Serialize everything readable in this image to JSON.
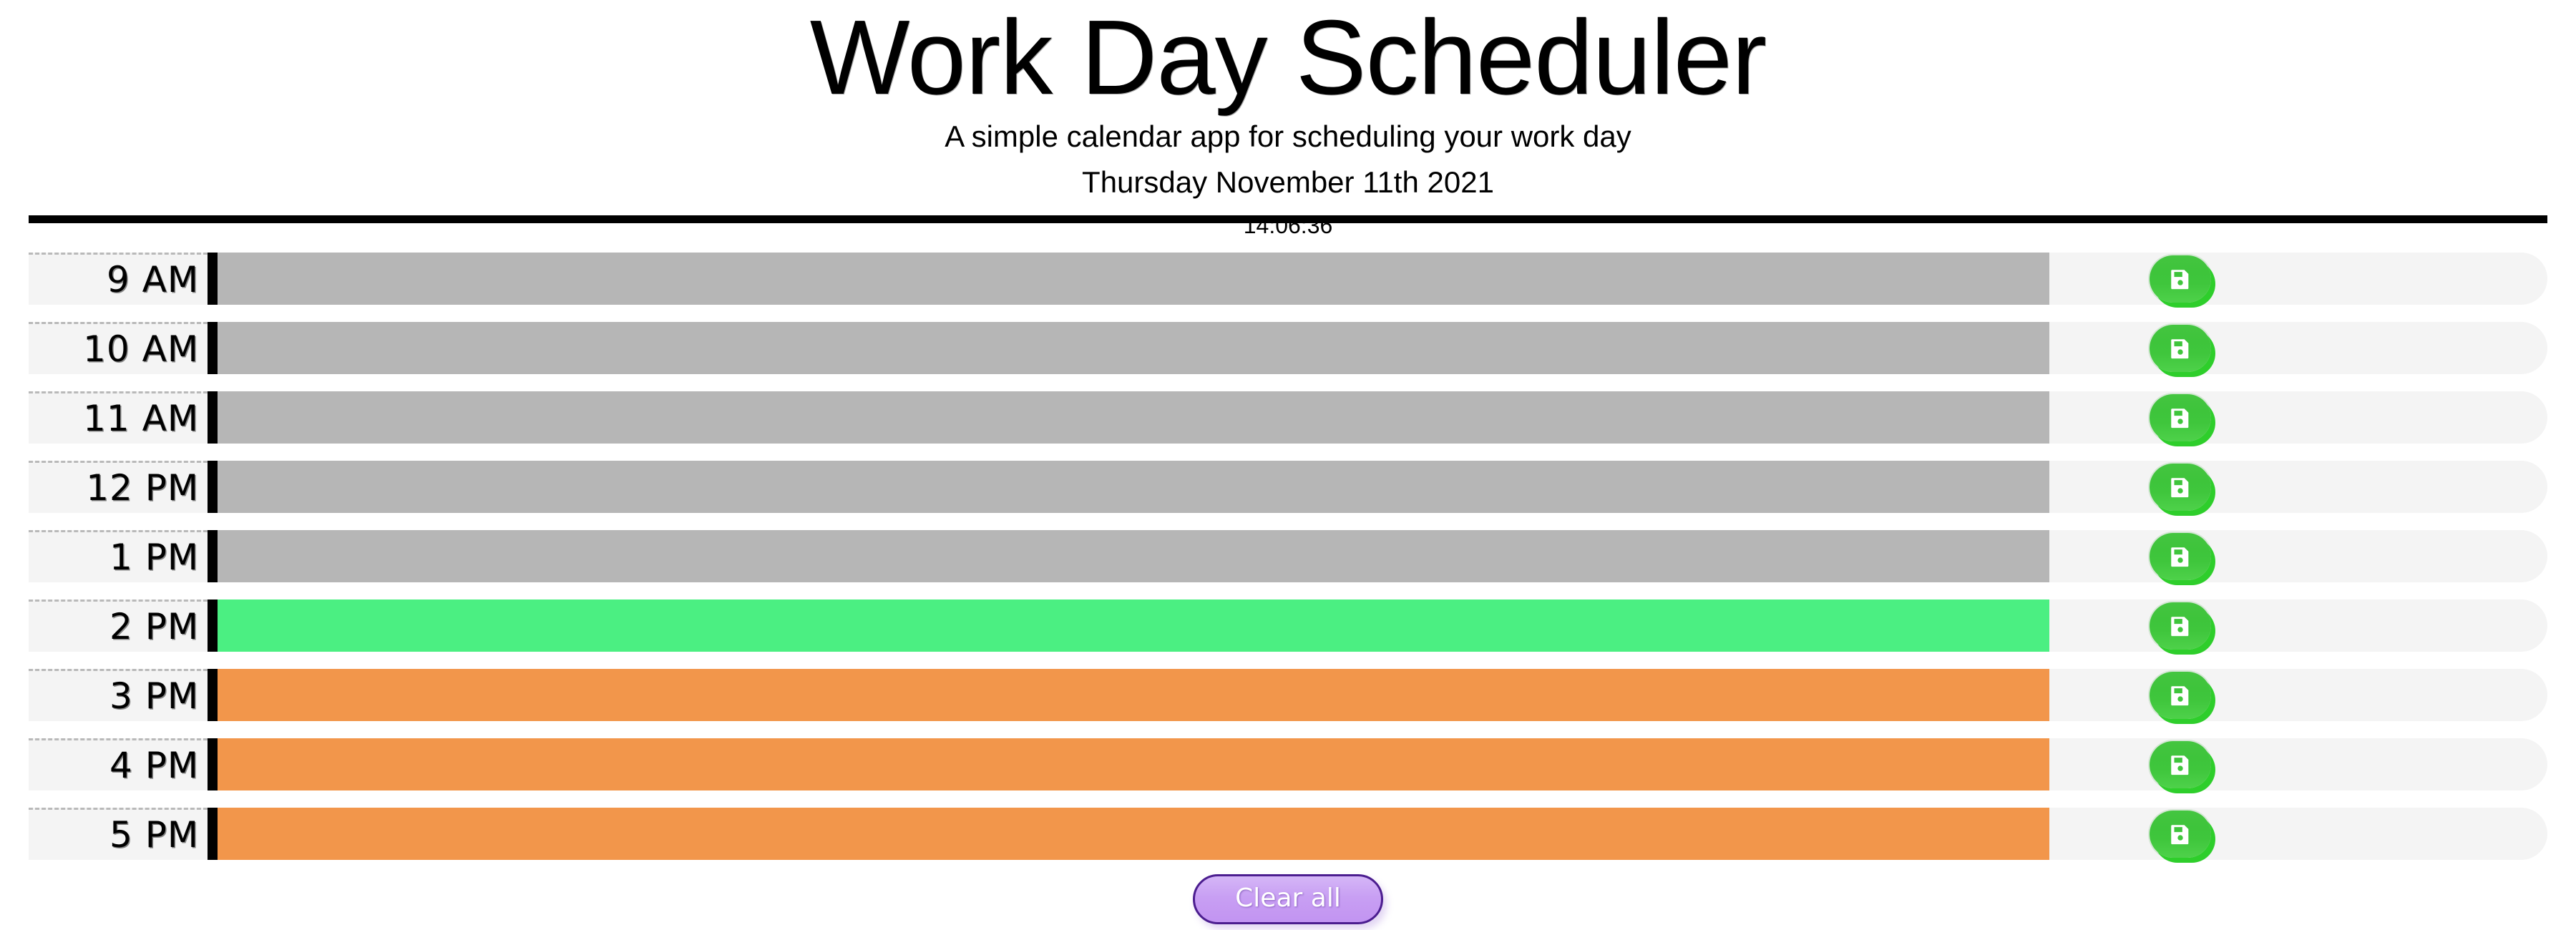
{
  "header": {
    "title": "Work Day Scheduler",
    "subtitle": "A simple calendar app for scheduling your work day",
    "current_day": "Thursday November 11th 2021",
    "current_time": "14:06:36"
  },
  "colors": {
    "past": "#b6b6b6",
    "present": "#4bef82",
    "future": "#f2964b",
    "row_background": "#f4f4f4",
    "save_button": "#3ec43b",
    "save_button_shadow": "#2ece2b",
    "clear_button_fill": "#c89ff3",
    "clear_button_border": "#4b1d8f",
    "divider": "#000000"
  },
  "schedule": {
    "save_icon_name": "floppy-disk-save-icon",
    "save_button_title": "Save",
    "event_placeholder": "",
    "blocks": [
      {
        "hour_label": "9 AM",
        "hour_id": "hour-9",
        "state": "past",
        "event_text": ""
      },
      {
        "hour_label": "10 AM",
        "hour_id": "hour-10",
        "state": "past",
        "event_text": ""
      },
      {
        "hour_label": "11 AM",
        "hour_id": "hour-11",
        "state": "past",
        "event_text": ""
      },
      {
        "hour_label": "12 PM",
        "hour_id": "hour-12",
        "state": "past",
        "event_text": ""
      },
      {
        "hour_label": "1 PM",
        "hour_id": "hour-13",
        "state": "past",
        "event_text": ""
      },
      {
        "hour_label": "2 PM",
        "hour_id": "hour-14",
        "state": "present",
        "event_text": ""
      },
      {
        "hour_label": "3 PM",
        "hour_id": "hour-15",
        "state": "future",
        "event_text": ""
      },
      {
        "hour_label": "4 PM",
        "hour_id": "hour-16",
        "state": "future",
        "event_text": ""
      },
      {
        "hour_label": "5 PM",
        "hour_id": "hour-17",
        "state": "future",
        "event_text": ""
      }
    ]
  },
  "footer": {
    "clear_label": "Clear all"
  }
}
